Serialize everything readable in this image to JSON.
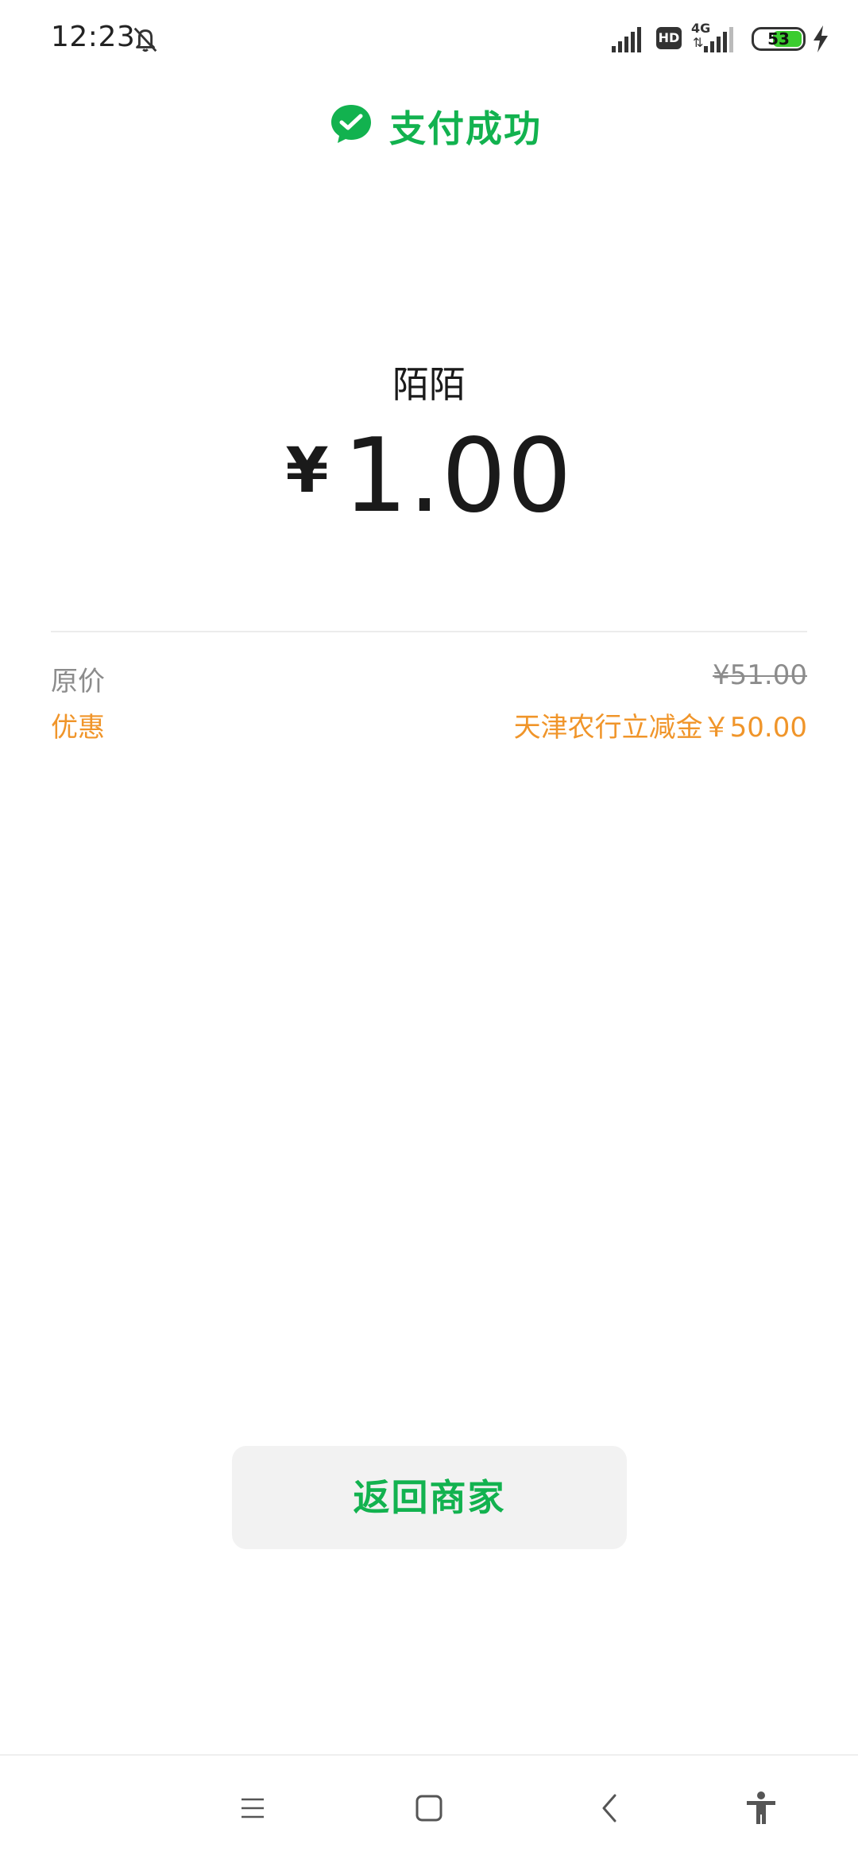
{
  "status_bar": {
    "time": "12:23",
    "network_label": "4G",
    "hd_label": "HD",
    "battery_level": "53",
    "icons": [
      "mute-bell-icon",
      "signal-icon",
      "hd-icon",
      "signal-4g-icon",
      "battery-icon",
      "charging-bolt-icon"
    ]
  },
  "header": {
    "title": "支付成功",
    "icon": "wechat-pay-icon",
    "accent_color": "#12b24f"
  },
  "payment": {
    "merchant": "陌陌",
    "currency_symbol": "¥",
    "amount": "1.00"
  },
  "details": {
    "original_label": "原价",
    "original_value": "¥51.00",
    "discount_label": "优惠",
    "discount_value": "天津农行立减金￥50.00",
    "discount_color": "#f0952a"
  },
  "actions": {
    "back_button_label": "返回商家"
  },
  "nav_bar": {
    "icons": [
      "menu-icon",
      "home-icon",
      "back-icon",
      "accessibility-icon"
    ]
  }
}
